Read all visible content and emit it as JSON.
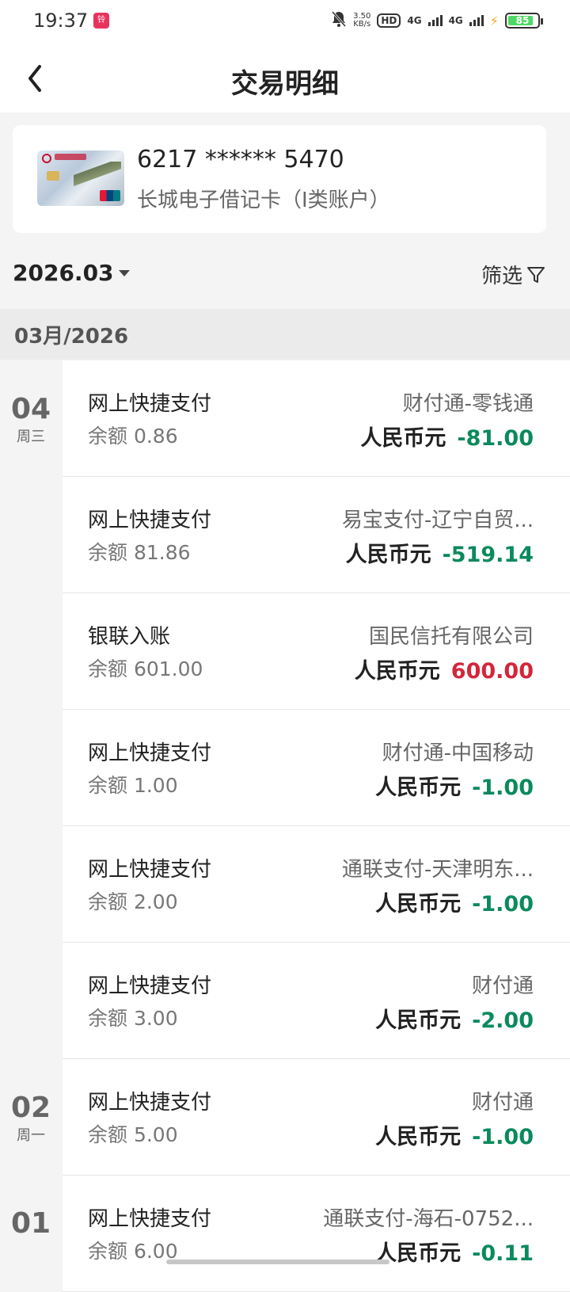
{
  "status": {
    "time": "19:37",
    "app_icon_text": "铃",
    "speed": "3.50",
    "speed_unit": "KB/s",
    "hd": "HD",
    "net1": "4G",
    "net2": "4G",
    "battery": "85",
    "battery_level": 0.85
  },
  "header": {
    "title": "交易明细"
  },
  "card": {
    "number": "6217 ****** 5470",
    "type": "长城电子借记卡（I类账户）"
  },
  "filter": {
    "month": "2026.03",
    "filter_label": "筛选"
  },
  "month_group": "03月/2026",
  "dates": [
    {
      "day": "04",
      "weekday": "周三"
    },
    {
      "day": "02",
      "weekday": "周一"
    },
    {
      "day": "01",
      "weekday": ""
    }
  ],
  "transactions": [
    {
      "type": "网上快捷支付",
      "balance": "余额 0.86",
      "merchant": "财付通-零钱通",
      "currency": "人民币元",
      "amount": "-81.00",
      "sign": "neg"
    },
    {
      "type": "网上快捷支付",
      "balance": "余额 81.86",
      "merchant": "易宝支付-辽宁自贸...",
      "currency": "人民币元",
      "amount": "-519.14",
      "sign": "neg"
    },
    {
      "type": "银联入账",
      "balance": "余额 601.00",
      "merchant": "国民信托有限公司",
      "currency": "人民币元",
      "amount": "600.00",
      "sign": "pos"
    },
    {
      "type": "网上快捷支付",
      "balance": "余额 1.00",
      "merchant": "财付通-中国移动",
      "currency": "人民币元",
      "amount": "-1.00",
      "sign": "neg"
    },
    {
      "type": "网上快捷支付",
      "balance": "余额 2.00",
      "merchant": "通联支付-天津明东...",
      "currency": "人民币元",
      "amount": "-1.00",
      "sign": "neg"
    },
    {
      "type": "网上快捷支付",
      "balance": "余额 3.00",
      "merchant": "财付通",
      "currency": "人民币元",
      "amount": "-2.00",
      "sign": "neg"
    },
    {
      "type": "网上快捷支付",
      "balance": "余额 5.00",
      "merchant": "财付通",
      "currency": "人民币元",
      "amount": "-1.00",
      "sign": "neg"
    },
    {
      "type": "网上快捷支付",
      "balance": "余额 6.00",
      "merchant": "通联支付-海石-0752...",
      "currency": "人民币元",
      "amount": "-0.11",
      "sign": "neg"
    }
  ]
}
